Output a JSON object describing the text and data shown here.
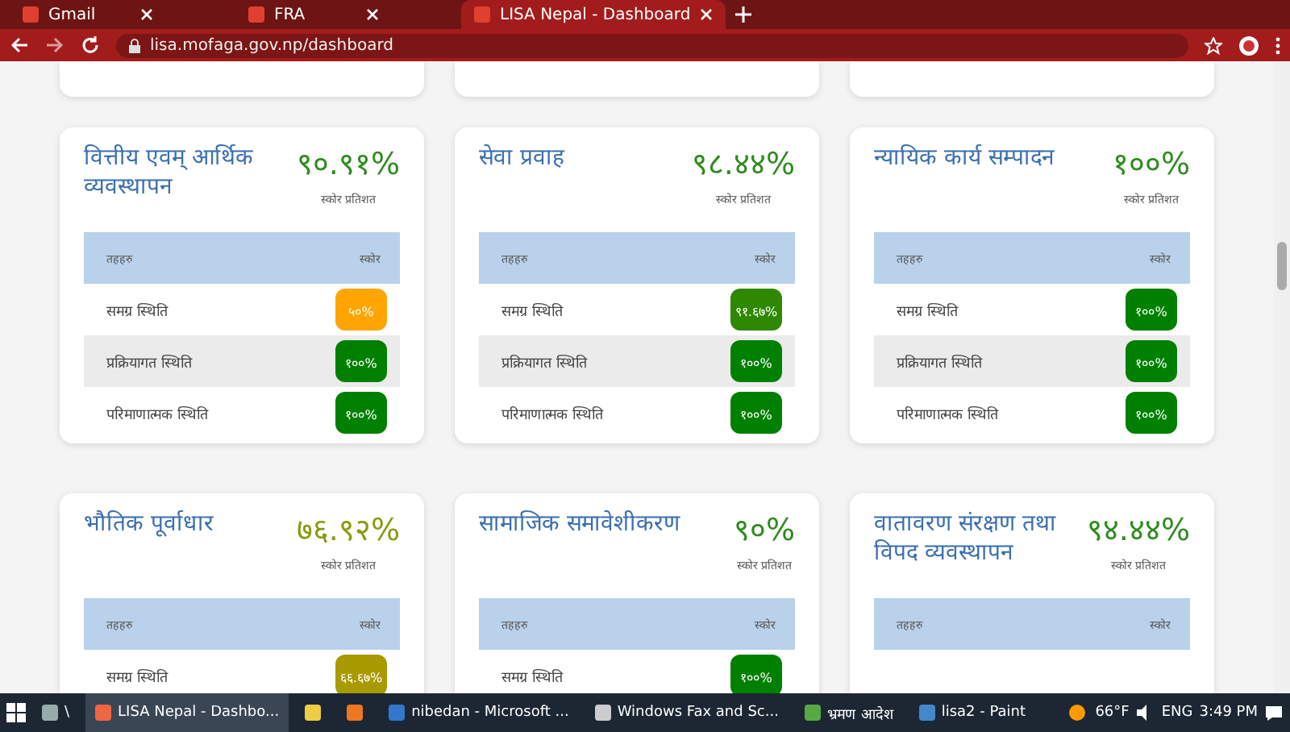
{
  "browser": {
    "tabs": [
      {
        "label": "Gmail",
        "selected": false
      },
      {
        "label": "FRA",
        "selected": false
      },
      {
        "label": "LISA Nepal - Dashboard",
        "selected": true
      }
    ],
    "address": "lisa.mofaga.gov.np/dashboard"
  },
  "cards": [
    {
      "title": "वित्तीय एवम् आर्थिक व्यवस्थापन",
      "score": "९०.९१%",
      "color": "#2e8b1e",
      "score_label": "स्कोर प्रतिशत",
      "columns": [
        "तहहरु",
        "स्कोर"
      ],
      "rows": [
        {
          "label": "समग्र स्थिति",
          "value": "५०%",
          "color": "#ffa500"
        },
        {
          "label": "प्रक्रियागत स्थिति",
          "value": "१००%",
          "color": "#008000"
        },
        {
          "label": "परिमाणात्मक स्थिति",
          "value": "१००%",
          "color": "#008000"
        }
      ]
    },
    {
      "title": "सेवा प्रवाह",
      "score": "९८.४४%",
      "color": "#2e8b1e",
      "score_label": "स्कोर प्रतिशत",
      "columns": [
        "तहहरु",
        "स्कोर"
      ],
      "rows": [
        {
          "label": "समग्र स्थिति",
          "value": "९१.६७%",
          "color": "#2e8800"
        },
        {
          "label": "प्रक्रियागत स्थिति",
          "value": "१००%",
          "color": "#008000"
        },
        {
          "label": "परिमाणात्मक स्थिति",
          "value": "१००%",
          "color": "#008000"
        }
      ]
    },
    {
      "title": "न्यायिक कार्य सम्पादन",
      "score": "१००%",
      "color": "#2e8b1e",
      "score_label": "स्कोर प्रतिशत",
      "columns": [
        "तहहरु",
        "स्कोर"
      ],
      "rows": [
        {
          "label": "समग्र स्थिति",
          "value": "१००%",
          "color": "#008000"
        },
        {
          "label": "प्रक्रियागत स्थिति",
          "value": "१००%",
          "color": "#008000"
        },
        {
          "label": "परिमाणात्मक स्थिति",
          "value": "१००%",
          "color": "#008000"
        }
      ]
    },
    {
      "title": "भौतिक पूर्वाधार",
      "score": "७६.९२%",
      "color": "#8a9a10",
      "score_label": "स्कोर प्रतिशत",
      "columns": [
        "तहहरु",
        "स्कोर"
      ],
      "rows": [
        {
          "label": "समग्र स्थिति",
          "value": "६६.६७%",
          "color": "#a89a00"
        }
      ]
    },
    {
      "title": "सामाजिक समावेशीकरण",
      "score": "९०%",
      "color": "#2e8b1e",
      "score_label": "स्कोर प्रतिशत",
      "columns": [
        "तहहरु",
        "स्कोर"
      ],
      "rows": [
        {
          "label": "समग्र स्थिति",
          "value": "१००%",
          "color": "#008000"
        }
      ]
    },
    {
      "title": "वातावरण संरक्षण तथा विपद व्यवस्थापन",
      "score": "९४.४४%",
      "color": "#2e8b1e",
      "score_label": "स्कोर प्रतिशत",
      "columns": [
        "तहहरु",
        "स्कोर"
      ]
    }
  ],
  "taskbar": {
    "items": [
      {
        "label": "\\",
        "selected": false
      },
      {
        "label": "LISA Nepal - Dashbo...",
        "selected": true
      },
      {
        "selected": false
      },
      {
        "selected": false
      },
      {
        "label": "nibedan - Microsoft ...",
        "selected": false
      },
      {
        "label": "Windows Fax and Sc...",
        "selected": false
      },
      {
        "label": "भ्रमण आदेश",
        "selected": false
      },
      {
        "label": "lisa2 - Paint",
        "selected": false
      }
    ],
    "weather": "66°F",
    "language": "ENG",
    "time": "3:49 PM"
  }
}
